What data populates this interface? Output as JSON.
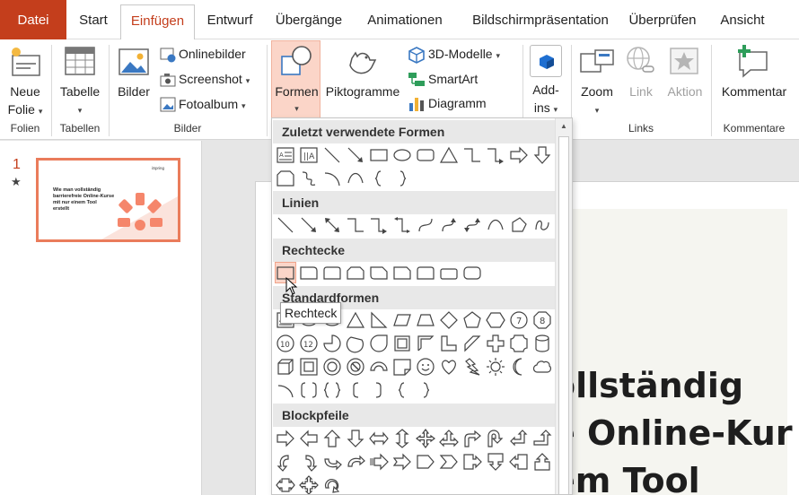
{
  "tabs": [
    "Datei",
    "Start",
    "Einfügen",
    "Entwurf",
    "Übergänge",
    "Animationen",
    "Bildschirmpräsentation",
    "Überprüfen",
    "Ansicht"
  ],
  "ribbon": {
    "neue_folie": "Neue",
    "neue_folie_2": "Folie",
    "tabelle": "Tabelle",
    "bilder": "Bilder",
    "onlinebilder": "Onlinebilder",
    "screenshot": "Screenshot",
    "fotoalbum": "Fotoalbum",
    "formen": "Formen",
    "piktogramme": "Piktogramme",
    "modelle_3d": "3D-Modelle",
    "smartart": "SmartArt",
    "diagramm": "Diagramm",
    "addins": "Add-",
    "addins_2": "ins",
    "zoom": "Zoom",
    "link": "Link",
    "aktion": "Aktion",
    "kommentar": "Kommentar",
    "groups": {
      "folien": "Folien",
      "tabellen": "Tabellen",
      "bilder": "Bilder",
      "links": "Links",
      "kommentare": "Kommentare"
    }
  },
  "slide_pane": {
    "number": "1",
    "thumb_logo": "iSpring",
    "thumb_text_1": "Wie man vollständig",
    "thumb_text_2": "barrierefreie Online-Kurse",
    "thumb_text_3": "mit nur einem Tool",
    "thumb_text_4": "erstellt"
  },
  "slide": {
    "line1": "ollständig",
    "line2": "e Online-Kur",
    "line3": "em Tool"
  },
  "shapes_menu": {
    "sections": [
      "Zuletzt verwendete Formen",
      "Linien",
      "Rechtecke",
      "Standardformen",
      "Blockpfeile"
    ],
    "tooltip": "Rechteck"
  },
  "colors": {
    "accent": "#c43e1c",
    "formen_active_bg": "#fbd5c8",
    "thumb_border": "#ea7c5b"
  }
}
